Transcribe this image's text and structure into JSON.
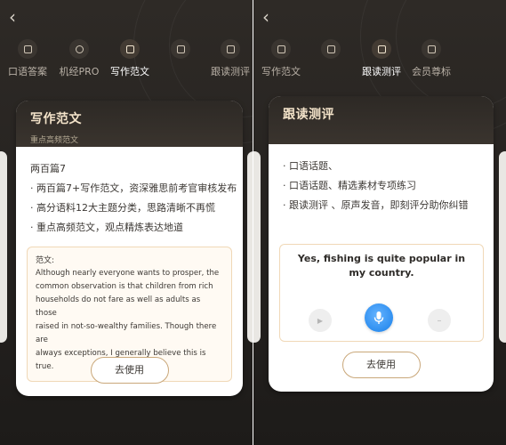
{
  "colors": {
    "background_dark": "#2a2522",
    "card_header": "#2d2925",
    "card_title": "#f3e3c9",
    "accent_border": "#f0d8b7",
    "button_border": "#c9a779",
    "mic_blue": "#2f8ff0"
  },
  "left": {
    "back_icon": "‹",
    "nav": [
      {
        "label": "口语答案",
        "icon": "book-icon"
      },
      {
        "label": "机经PRO",
        "icon": "target-icon"
      },
      {
        "label": "写作范文",
        "icon": "document-icon"
      },
      {
        "label": "",
        "icon": "tv-icon"
      },
      {
        "label": "跟读测评",
        "icon": "robot-icon"
      }
    ],
    "card": {
      "title": "写作范文",
      "subtitle": "重点高频范文",
      "lines": [
        "两百篇7",
        "· 两百篇7+写作范文，资深雅思前考官审核发布",
        "· 高分语料12大主题分类，思路清晰不再慌",
        "· 重点高频范文，观点精炼表达地道"
      ],
      "example_title": "范文:",
      "example_lines": [
        "Although nearly everyone wants to prosper, the",
        "common observation is that children from rich",
        "households do not fare as well as adults as those",
        "raised in not-so-wealthy families.  Though there are",
        "always exceptions, I generally believe this is true."
      ],
      "button": "去使用"
    }
  },
  "right": {
    "back_icon": "‹",
    "nav": [
      {
        "label": "写作范文",
        "icon": "document-icon"
      },
      {
        "label": "",
        "icon": "tv-icon"
      },
      {
        "label": "跟读测评",
        "icon": "robot-icon"
      },
      {
        "label": "会员尊标",
        "icon": "member-icon"
      }
    ],
    "card": {
      "title": "跟读测评",
      "lines": [
        "· 口语话题、",
        "· 口语话题、精选素材专项练习",
        "· 跟读测评 、原声发音，即刻评分助你纠错"
      ],
      "sentence": "Yes, fishing is quite popular in my country.",
      "controls": {
        "play": "▶",
        "mic": "microphone-icon",
        "minus": "–"
      },
      "button": "去使用"
    }
  }
}
